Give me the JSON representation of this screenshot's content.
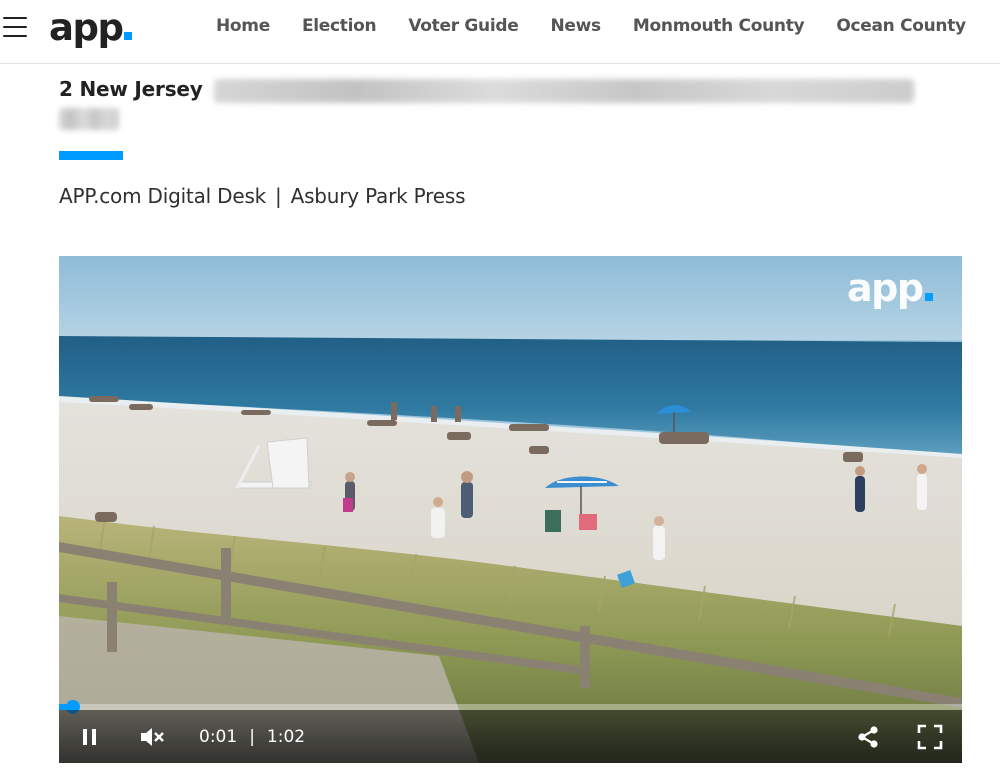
{
  "header": {
    "logo_text": "app",
    "nav": [
      "Home",
      "Election",
      "Voter Guide",
      "News",
      "Monmouth County",
      "Ocean County"
    ]
  },
  "article": {
    "headline_visible": "2 New Jersey",
    "byline_author": "APP.com Digital Desk",
    "byline_separator": "|",
    "byline_outlet": "Asbury Park Press"
  },
  "video": {
    "watermark_text": "app",
    "current_time": "0:01",
    "time_separator": "|",
    "duration": "1:02",
    "progress_fraction": 0.016,
    "icons": [
      "pause-icon",
      "mute-icon",
      "share-icon",
      "fullscreen-icon"
    ]
  },
  "colors": {
    "accent": "#009bff",
    "text": "#303030"
  }
}
